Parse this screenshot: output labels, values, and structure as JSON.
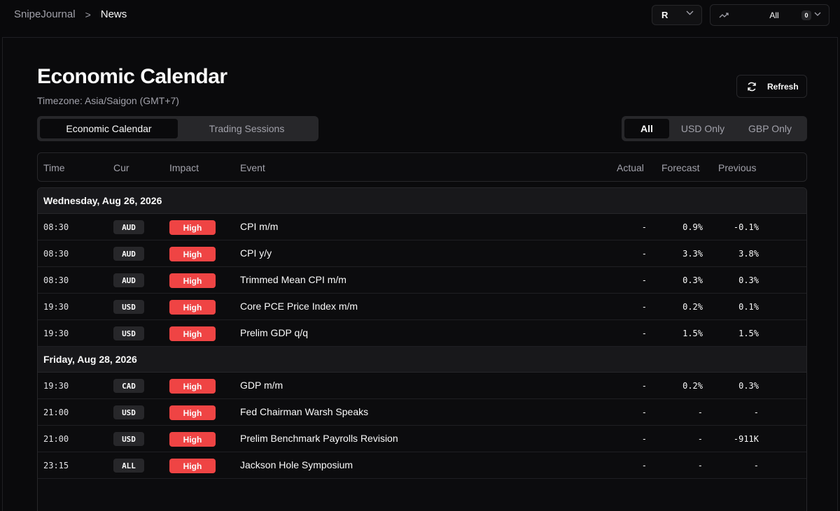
{
  "breadcrumb": {
    "app": "SnipeJournal",
    "separator": ">",
    "current": "News"
  },
  "account": {
    "label": "R",
    "icon": "chevron-down-icon"
  },
  "filter": {
    "icon": "trend-icon",
    "label": "All",
    "count": "0"
  },
  "page": {
    "title": "Economic Calendar",
    "timezone": "Timezone: Asia/Saigon (GMT+7)"
  },
  "refresh": {
    "label": "Refresh",
    "icon": "refresh-icon"
  },
  "tabs": [
    {
      "label": "Economic Calendar",
      "active": true
    },
    {
      "label": "Trading Sessions",
      "active": false
    }
  ],
  "currency_filter": [
    {
      "label": "All",
      "active": true
    },
    {
      "label": "USD Only",
      "active": false
    },
    {
      "label": "GBP Only",
      "active": false
    }
  ],
  "table": {
    "headers": {
      "time": "Time",
      "cur": "Cur",
      "impact": "Impact",
      "event": "Event",
      "actual": "Actual",
      "forecast": "Forecast",
      "previous": "Previous"
    },
    "groups": [
      {
        "date": "Wednesday, Aug 26, 2026",
        "rows": [
          {
            "time": "08:30",
            "cur": "AUD",
            "impact": "High",
            "event": "CPI m/m",
            "actual": "-",
            "forecast": "0.9%",
            "previous": "-0.1%"
          },
          {
            "time": "08:30",
            "cur": "AUD",
            "impact": "High",
            "event": "CPI y/y",
            "actual": "-",
            "forecast": "3.3%",
            "previous": "3.8%"
          },
          {
            "time": "08:30",
            "cur": "AUD",
            "impact": "High",
            "event": "Trimmed Mean CPI m/m",
            "actual": "-",
            "forecast": "0.3%",
            "previous": "0.3%"
          },
          {
            "time": "19:30",
            "cur": "USD",
            "impact": "High",
            "event": "Core PCE Price Index m/m",
            "actual": "-",
            "forecast": "0.2%",
            "previous": "0.1%"
          },
          {
            "time": "19:30",
            "cur": "USD",
            "impact": "High",
            "event": "Prelim GDP q/q",
            "actual": "-",
            "forecast": "1.5%",
            "previous": "1.5%"
          }
        ]
      },
      {
        "date": "Friday, Aug 28, 2026",
        "rows": [
          {
            "time": "19:30",
            "cur": "CAD",
            "impact": "High",
            "event": "GDP m/m",
            "actual": "-",
            "forecast": "0.2%",
            "previous": "0.3%"
          },
          {
            "time": "21:00",
            "cur": "USD",
            "impact": "High",
            "event": "Fed Chairman Warsh Speaks",
            "actual": "-",
            "forecast": "-",
            "previous": "-"
          },
          {
            "time": "21:00",
            "cur": "USD",
            "impact": "High",
            "event": "Prelim Benchmark Payrolls Revision",
            "actual": "-",
            "forecast": "-",
            "previous": "-911K"
          },
          {
            "time": "23:15",
            "cur": "ALL",
            "impact": "High",
            "event": "Jackson Hole Symposium",
            "actual": "-",
            "forecast": "-",
            "previous": "-"
          }
        ]
      }
    ]
  },
  "colors": {
    "background": "#09090b",
    "high_impact": "#ef4444",
    "muted": "#a1a1aa"
  }
}
